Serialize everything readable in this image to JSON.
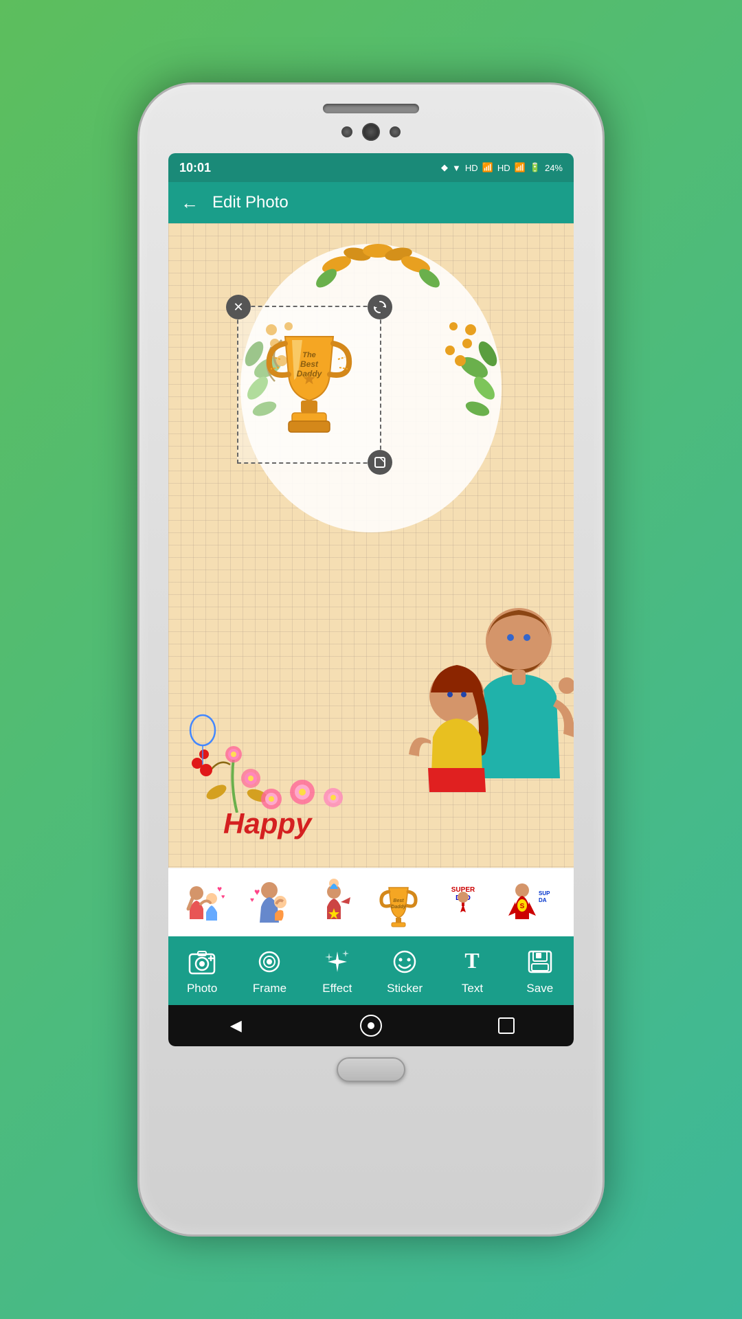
{
  "status": {
    "time": "10:01",
    "battery": "24%",
    "network": "HD"
  },
  "header": {
    "title": "Edit Photo",
    "back_label": "←"
  },
  "canvas": {
    "happy_text": "Happy"
  },
  "stickers": {
    "items": [
      {
        "id": "sticker-1",
        "emoji": "👨‍👧"
      },
      {
        "id": "sticker-2",
        "emoji": "👨‍👶"
      },
      {
        "id": "sticker-3",
        "emoji": "🦸‍♂️"
      },
      {
        "id": "sticker-4",
        "emoji": "🏆"
      },
      {
        "id": "sticker-5",
        "label": "Super Dad"
      },
      {
        "id": "sticker-6",
        "label": "Sup Da"
      }
    ]
  },
  "toolbar": {
    "items": [
      {
        "id": "photo",
        "label": "Photo",
        "icon": "camera-plus-icon"
      },
      {
        "id": "frame",
        "label": "Frame",
        "icon": "frame-icon"
      },
      {
        "id": "effect",
        "label": "Effect",
        "icon": "sparkle-icon"
      },
      {
        "id": "sticker",
        "label": "Sticker",
        "icon": "sticker-icon"
      },
      {
        "id": "text",
        "label": "Text",
        "icon": "text-icon"
      },
      {
        "id": "save",
        "label": "Save",
        "icon": "save-icon"
      }
    ]
  },
  "nav": {
    "back": "◀",
    "home": "⬤",
    "recent": "■"
  }
}
